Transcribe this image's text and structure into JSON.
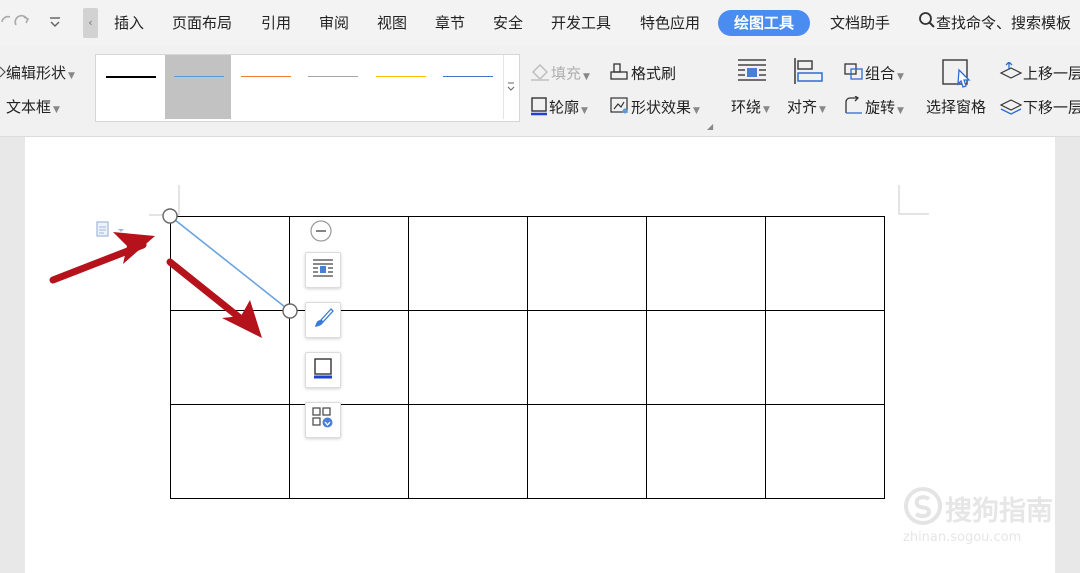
{
  "quick_access": {
    "undo_icon": "undo-icon",
    "redo_icon": "redo-icon",
    "more_icon": "dropdown-icon"
  },
  "menu": {
    "tabs": [
      {
        "label": "插入"
      },
      {
        "label": "页面布局"
      },
      {
        "label": "引用"
      },
      {
        "label": "审阅"
      },
      {
        "label": "视图"
      },
      {
        "label": "章节"
      },
      {
        "label": "安全"
      },
      {
        "label": "开发工具"
      },
      {
        "label": "特色应用"
      },
      {
        "label": "绘图工具"
      },
      {
        "label": "文档助手"
      }
    ],
    "active_tab": "绘图工具",
    "search_label": "查找命令、搜索模板"
  },
  "ribbon": {
    "edit_shape": "编辑形状",
    "text_box": "文本框",
    "fill": "填充",
    "format_painter": "格式刷",
    "outline": "轮廓",
    "shape_effects": "形状效果",
    "wrap": "环绕",
    "align": "对齐",
    "group": "组合",
    "rotate": "旋转",
    "selection_pane": "选择窗格",
    "bring_forward": "上移一层",
    "send_backward": "下移一层",
    "line_styles": [
      {
        "color": "#000000",
        "selected": false
      },
      {
        "color": "#5b9bd5",
        "selected": true
      },
      {
        "color": "#ed7d31",
        "selected": false
      },
      {
        "color": "#a5a5a5",
        "selected": false
      },
      {
        "color": "#ffc000",
        "selected": false
      },
      {
        "color": "#4472c4",
        "selected": false
      }
    ]
  },
  "document": {
    "table": {
      "rows": 3,
      "cols": 6
    },
    "floating_toolbar": [
      "wrap-text-icon",
      "shape-style-icon",
      "outline-icon",
      "more-options-icon"
    ],
    "annotation_color": "#b5121b",
    "line_color": "#6aa3de"
  },
  "watermark": {
    "brand": "搜狗指南",
    "url": "zhinan.sogou.com"
  },
  "colors": {
    "accent": "#4a8cf0"
  }
}
